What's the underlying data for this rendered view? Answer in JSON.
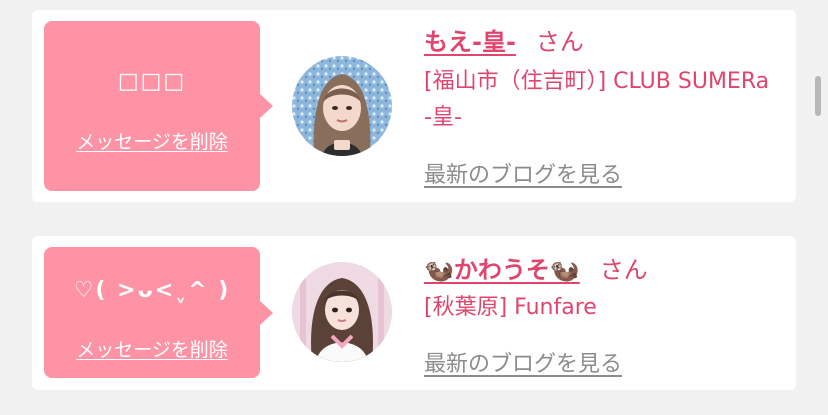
{
  "messages": [
    {
      "bubble_text": "□□□",
      "delete_label": "メッセージを削除",
      "name": "もえ-皇-",
      "honorific": "さん",
      "shop": "[福山市（住吉町）] CLUB SUMERa -皇-",
      "blog_link": "最新のブログを見る"
    },
    {
      "bubble_text": "♡( >ᴗ<ˬ^ )",
      "delete_label": "メッセージを削除",
      "name": "🦦かわうそ🦦",
      "honorific": "さん",
      "shop": "[秋葉原] Funfare",
      "blog_link": "最新のブログを見る"
    }
  ],
  "colors": {
    "bubble": "#ff93a6",
    "accent": "#e0456d",
    "link_gray": "#8c8c8c",
    "background": "#f1f1f1",
    "card": "#ffffff"
  }
}
